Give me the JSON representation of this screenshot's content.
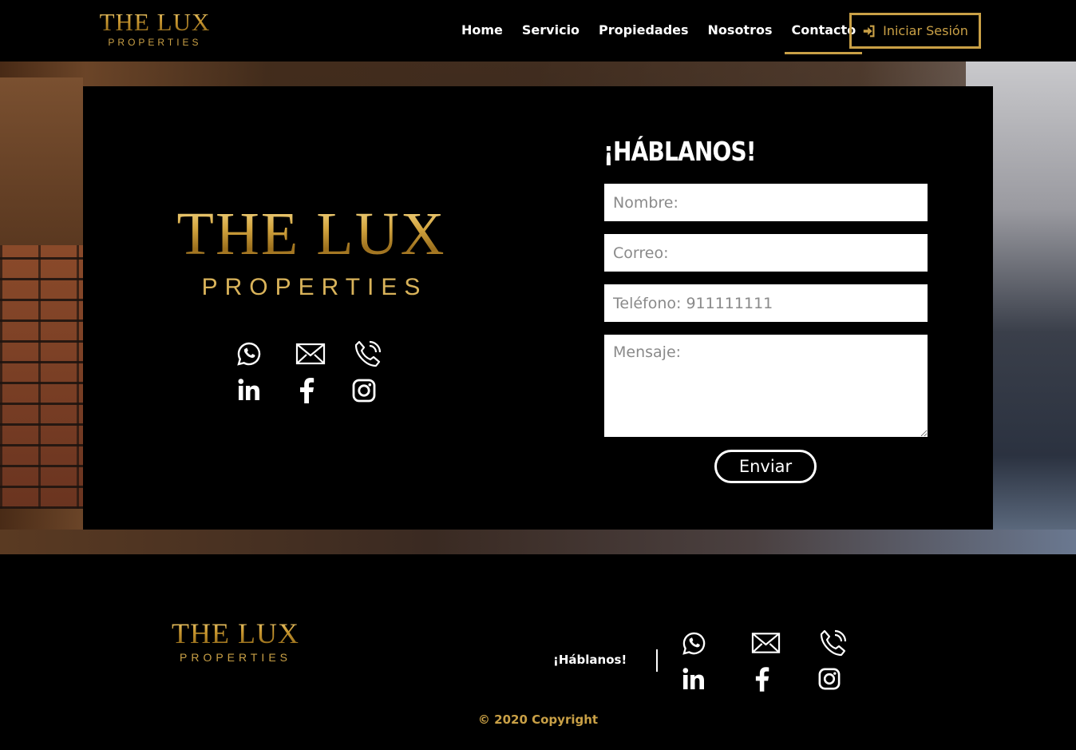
{
  "brand": {
    "line1": "THE LUX",
    "line2": "PROPERTIES"
  },
  "nav": {
    "items": [
      {
        "label": "Home"
      },
      {
        "label": "Servicio"
      },
      {
        "label": "Propiedades"
      },
      {
        "label": "Nosotros"
      },
      {
        "label": "Contacto",
        "active": true
      }
    ],
    "login_label": "Iniciar Sesión"
  },
  "contact": {
    "title": "¡HÁBLANOS!",
    "fields": {
      "name_placeholder": "Nombre:",
      "email_placeholder": "Correo:",
      "phone_placeholder": "Teléfono: 911111111",
      "message_placeholder": "Mensaje:"
    },
    "send_label": "Enviar",
    "social_icons": [
      "whatsapp-icon",
      "mail-icon",
      "phone-icon",
      "linkedin-icon",
      "facebook-icon",
      "instagram-icon"
    ]
  },
  "footer": {
    "talk_label": "¡Háblanos!",
    "copyright": "© 2020 Copyright"
  },
  "colors": {
    "accent": "#c9a046",
    "background": "#000000",
    "text": "#ffffff"
  }
}
